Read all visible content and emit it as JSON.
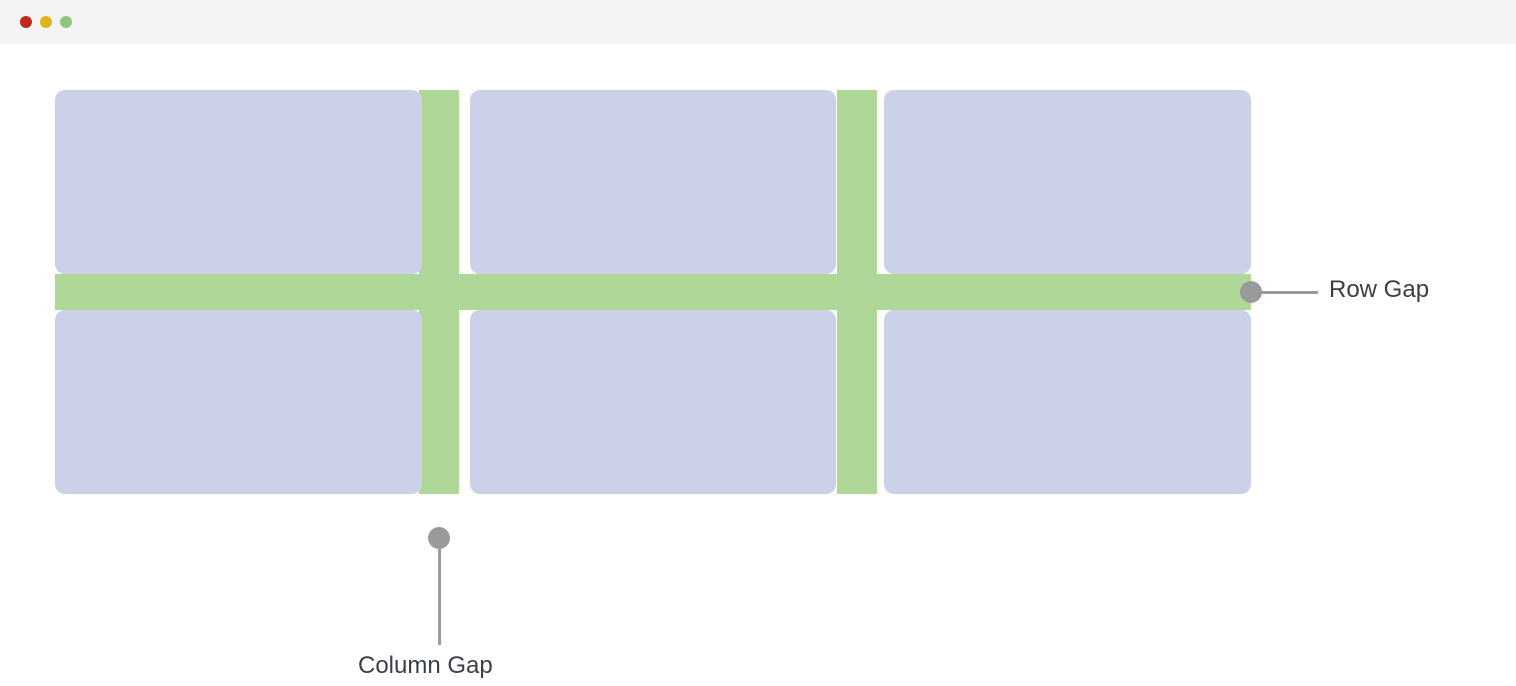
{
  "labels": {
    "row_gap": "Row Gap",
    "column_gap": "Column Gap"
  },
  "colors": {
    "cell": "#cbd1e8",
    "gap": "#aed798",
    "callout": "#9a9a9a",
    "text": "#3a3f46",
    "titlebar": "#f4f4f5",
    "traffic_red": "#c1291d",
    "traffic_yellow": "#dcb41e",
    "traffic_green": "#8fc680"
  },
  "grid": {
    "columns": 3,
    "rows": 2
  }
}
